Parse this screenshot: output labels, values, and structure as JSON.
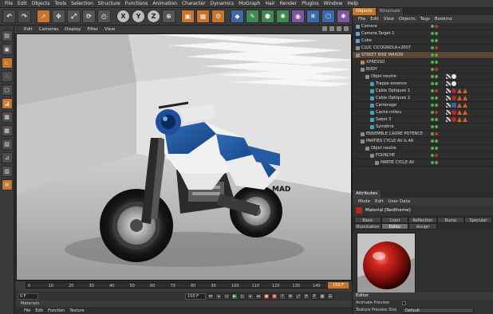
{
  "app_menu": [
    "File",
    "Edit",
    "Objects",
    "Tools",
    "Selection",
    "Structure",
    "Functions",
    "Animation",
    "Character",
    "Dynamics",
    "MoGraph",
    "Hair",
    "Render",
    "Plugins",
    "Window",
    "Help"
  ],
  "toolbar": {
    "icons": [
      "undo-icon",
      "redo-icon",
      "select-live-icon",
      "move-icon",
      "scale-icon",
      "rotate-icon",
      "last-tool-icon",
      "x-axis-icon",
      "y-axis-icon",
      "z-axis-icon",
      "world-coords-icon",
      "render-view-icon",
      "render-picture-icon",
      "render-settings-icon",
      "cube-icon",
      "pen-icon",
      "subdivision-icon",
      "array-icon",
      "boole-icon",
      "deformer-icon",
      "scene-icon",
      "light-icon"
    ],
    "axis_labels": [
      "X",
      "Y",
      "Z"
    ]
  },
  "left_tools": [
    "make-editable-icon",
    "model-icon",
    "object-axis-icon",
    "points-icon",
    "edges-icon",
    "polygons-icon",
    "uv-icon",
    "texture-icon",
    "workplane-icon",
    "snap-icon",
    "animation-icon",
    "quantize-icon"
  ],
  "viewport": {
    "menu": [
      "Edit",
      "Cameras",
      "Display",
      "Filter",
      "View"
    ]
  },
  "timeline": {
    "ticks": [
      "0",
      "10",
      "20",
      "30",
      "40",
      "50",
      "60",
      "70",
      "80",
      "90",
      "100",
      "110",
      "120",
      "130",
      "140"
    ],
    "end_frame": "150 F"
  },
  "transport": {
    "start": "0 F",
    "current": "150 F"
  },
  "materials": {
    "title": "Materials",
    "menu": [
      "File",
      "Edit",
      "Function",
      "Texture"
    ]
  },
  "object_manager": {
    "tabs": [
      "Objects",
      "Structure"
    ],
    "active_tab": "Objects",
    "menu": [
      "File",
      "Edit",
      "View",
      "Objects",
      "Tags",
      "Bookmz"
    ],
    "rows": [
      {
        "name": "Camera",
        "indent": 0,
        "icon": "camera-icon"
      },
      {
        "name": "Camera.Target.1",
        "indent": 0,
        "icon": "target-icon"
      },
      {
        "name": "Cube",
        "indent": 0,
        "icon": "cube-icon"
      },
      {
        "name": "CLUC CICOGNOLA+2007",
        "indent": 0,
        "icon": "null-icon"
      },
      {
        "name": "STREET BIKE MAXON",
        "indent": 0,
        "icon": "null-icon"
      },
      {
        "name": "XPRESSO",
        "indent": 1,
        "icon": "xpresso-icon"
      },
      {
        "name": "BODY",
        "indent": 1,
        "icon": "null-icon"
      },
      {
        "name": "Objet neutre",
        "indent": 2,
        "icon": "null-icon"
      },
      {
        "name": "Trappe essence",
        "indent": 3,
        "icon": "object-icon"
      },
      {
        "name": "Cable Optiques 1",
        "indent": 3,
        "icon": "object-icon"
      },
      {
        "name": "Cable Optiques 2",
        "indent": 3,
        "icon": "object-icon"
      },
      {
        "name": "Carrenage",
        "indent": 3,
        "icon": "object-icon"
      },
      {
        "name": "Cache milieu",
        "indent": 3,
        "icon": "object-icon"
      },
      {
        "name": "Sabot 3",
        "indent": 3,
        "icon": "object-icon"
      },
      {
        "name": "Symétrie",
        "indent": 3,
        "icon": "symmetry-icon"
      },
      {
        "name": "ENSEMBLE CADRE POTENCE",
        "indent": 1,
        "icon": "null-icon"
      },
      {
        "name": "PARTIES CYCLE AV & AR",
        "indent": 1,
        "icon": "null-icon"
      },
      {
        "name": "Objet neutre",
        "indent": 2,
        "icon": "null-icon"
      },
      {
        "name": "FOURCHE",
        "indent": 3,
        "icon": "null-icon"
      },
      {
        "name": "PARTIE CYCLE AV",
        "indent": 4,
        "icon": "null-icon"
      }
    ]
  },
  "attributes": {
    "title": "Attributes",
    "menu": [
      "Mode",
      "Edit",
      "User Data"
    ],
    "material_name": "Material [Redtheme]",
    "tabs_row1": [
      "Basic",
      "Color",
      "Reflection",
      "Bump",
      "Specular"
    ],
    "tabs_row2": [
      "Illumination",
      "Editor",
      "Assign"
    ],
    "active_tab": "Editor",
    "editor_section": "Editor",
    "options": [
      {
        "label": "Animate Preview"
      },
      {
        "label": "Texture Preview Size",
        "value": "Default"
      }
    ]
  },
  "colors": {
    "accent": "#c8742b",
    "material": "#b4271f"
  }
}
